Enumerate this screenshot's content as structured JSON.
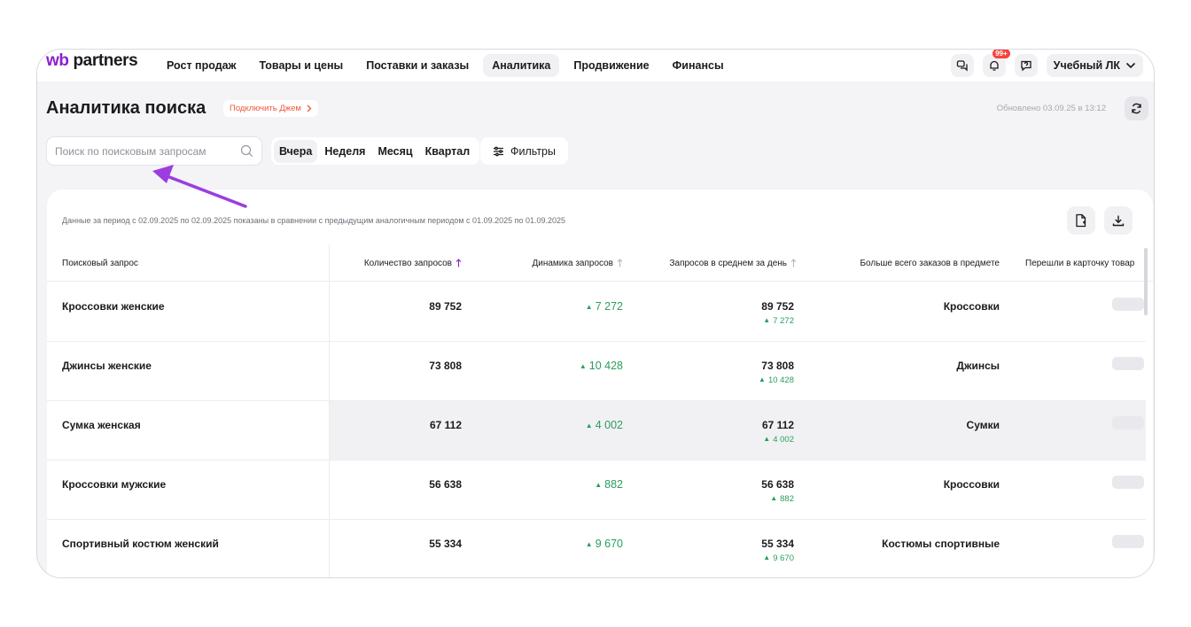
{
  "app": {
    "logo_prefix": "wb",
    "logo_rest": " partners"
  },
  "nav": [
    {
      "label": "Рост продаж",
      "active": false
    },
    {
      "label": "Товары и цены",
      "active": false
    },
    {
      "label": "Поставки и заказы",
      "active": false
    },
    {
      "label": "Аналитика",
      "active": true
    },
    {
      "label": "Продвижение",
      "active": false
    },
    {
      "label": "Финансы",
      "active": false
    }
  ],
  "header": {
    "notification_badge": "99+",
    "account_label": "Учебный ЛК"
  },
  "page": {
    "title": "Аналитика поиска",
    "jam_label": "Подключить Джем",
    "updated": "Обновлено 03.09.25 в 13:12"
  },
  "search": {
    "placeholder": "Поиск по поисковым запросам",
    "value": ""
  },
  "periods": [
    {
      "label": "Вчера",
      "active": true
    },
    {
      "label": "Неделя",
      "active": false
    },
    {
      "label": "Месяц",
      "active": false
    },
    {
      "label": "Квартал",
      "active": false
    }
  ],
  "filters_label": "Фильтры",
  "table": {
    "note": "Данные за период с 02.09.2025 по 02.09.2025 показаны в сравнении с предыдущим аналогичным периодом с 01.09.2025 по 01.09.2025",
    "columns": {
      "query": "Поисковый запрос",
      "count": "Количество запросов",
      "dynamics": "Динамика запросов",
      "avg": "Запросов в среднем за день",
      "subject": "Больше всего заказов в предмете",
      "card": "Перешли в карточку товар"
    },
    "rows": [
      {
        "query": "Кроссовки женские",
        "count": "89 752",
        "dynamics": "7 272",
        "avg": "89 752",
        "avg_delta": "7 272",
        "subject": "Кроссовки"
      },
      {
        "query": "Джинсы женские",
        "count": "73 808",
        "dynamics": "10 428",
        "avg": "73 808",
        "avg_delta": "10 428",
        "subject": "Джинсы"
      },
      {
        "query": "Сумка женская",
        "count": "67 112",
        "dynamics": "4 002",
        "avg": "67 112",
        "avg_delta": "4 002",
        "subject": "Сумки"
      },
      {
        "query": "Кроссовки мужские",
        "count": "56 638",
        "dynamics": "882",
        "avg": "56 638",
        "avg_delta": "882",
        "subject": "Кроссовки"
      },
      {
        "query": "Спортивный костюм женский",
        "count": "55 334",
        "dynamics": "9 670",
        "avg": "55 334",
        "avg_delta": "9 670",
        "subject": "Костюмы спортивные"
      }
    ]
  },
  "colors": {
    "brand": "#8b1fd0",
    "positive": "#2a9d5c",
    "annotation_arrow": "#9b3de0",
    "jam": "#f0573b"
  }
}
